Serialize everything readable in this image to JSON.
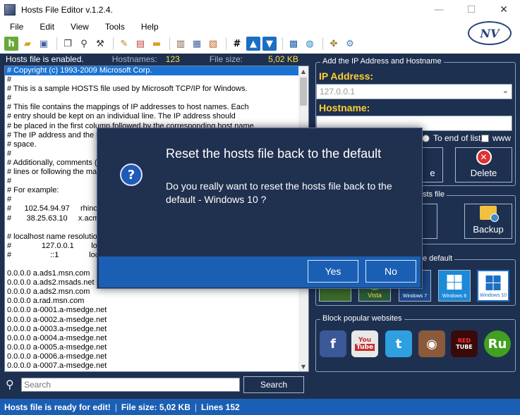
{
  "window": {
    "title": "Hosts File Editor v.1.2.4.",
    "minimize_glyph": "—",
    "maximize_glyph": "☐",
    "close_glyph": "✕"
  },
  "menu": [
    "File",
    "Edit",
    "View",
    "Tools",
    "Help"
  ],
  "toolbar": {
    "hash_glyph": "#",
    "logo_text": "NV"
  },
  "info": {
    "status": "Hosts file is enabled.",
    "hostnames_label": "Hostnames:",
    "hostnames_value": "123",
    "filesize_label": "File size:",
    "filesize_value": "5,02 KB"
  },
  "editor_lines": [
    "# Copyright (c) 1993-2009 Microsoft Corp.",
    "#",
    "# This is a sample HOSTS file used by Microsoft TCP/IP for Windows.",
    "#",
    "# This file contains the mappings of IP addresses to host names. Each",
    "# entry should be kept on an individual line. The IP address should",
    "# be placed in the first column followed by the corresponding host name.",
    "# The IP address and the h",
    "# space.",
    "#",
    "# Additionally, comments (s",
    "# lines or following the mac",
    "#",
    "# For example:",
    "#",
    "#      102.54.94.97     rhino",
    "#       38.25.63.10     x.acm",
    "",
    "# localhost name resolution",
    "#              127.0.0.1        loca",
    "#                  ::1              localh",
    "",
    "0.0.0.0 a.ads1.msn.com",
    "0.0.0.0 a.ads2.msads.net",
    "0.0.0.0 a.ads2.msn.com",
    "0.0.0.0 a.rad.msn.com",
    "0.0.0.0 a-0001.a-msedge.net",
    "0.0.0.0 a-0002.a-msedge.net",
    "0.0.0.0 a-0003.a-msedge.net",
    "0.0.0.0 a-0004.a-msedge.net",
    "0.0.0.0 a-0005.a-msedge.net",
    "0.0.0.0 a-0006.a-msedge.net",
    "0.0.0.0 a-0007.a-msedge.net"
  ],
  "search": {
    "placeholder": "Search",
    "button_label": "Search"
  },
  "statusbar": {
    "ready": "Hosts file is ready for edit!",
    "sep": "|",
    "filesize": "File size:  5,02 KB",
    "lines": "Lines 152"
  },
  "right_panel": {
    "add_group_title": "Add the IP Address  and Hostname",
    "ip_label": "IP Address:",
    "ip_value": "127.0.0.1",
    "hostname_label": "Hostname:",
    "to_end_label": "To end of list",
    "www_label": "www",
    "add_button_fragment": "e",
    "delete_label": "Delete",
    "file_group_fragment": "sts file",
    "backup_label": "Backup",
    "default_group_fragment": "e default",
    "block_group_title": "Block popular websites"
  },
  "os_tiles": [
    {
      "label": "",
      "color": "#3a7a2a"
    },
    {
      "label": "Vista",
      "color": "#2a6a3a"
    },
    {
      "label": "Windows 7",
      "color": "#1c4a8a"
    },
    {
      "label": "Windows 8",
      "color": "#1c8ad8"
    },
    {
      "label": "Windows 10",
      "color": "#ffffff"
    }
  ],
  "social": [
    {
      "name": "facebook",
      "glyph": "f",
      "color": "#3b5998"
    },
    {
      "name": "youtube",
      "glyph": "You\nTube",
      "color": "#c4302b"
    },
    {
      "name": "twitter",
      "glyph": "t",
      "color": "#2ea0e0"
    },
    {
      "name": "instagram",
      "glyph": "◉",
      "color": "#8a5a3a"
    },
    {
      "name": "redtube",
      "glyph": "RED\nTUBE",
      "color": "#6a1010"
    },
    {
      "name": "ru",
      "glyph": "Ru",
      "color": "#40a020"
    }
  ],
  "dialog": {
    "icon_glyph": "?",
    "title": "Reset the hosts file back to the default",
    "message": "Do you really want to reset the hosts file back to the default - Windows 10 ?",
    "yes_label": "Yes",
    "no_label": "No"
  }
}
